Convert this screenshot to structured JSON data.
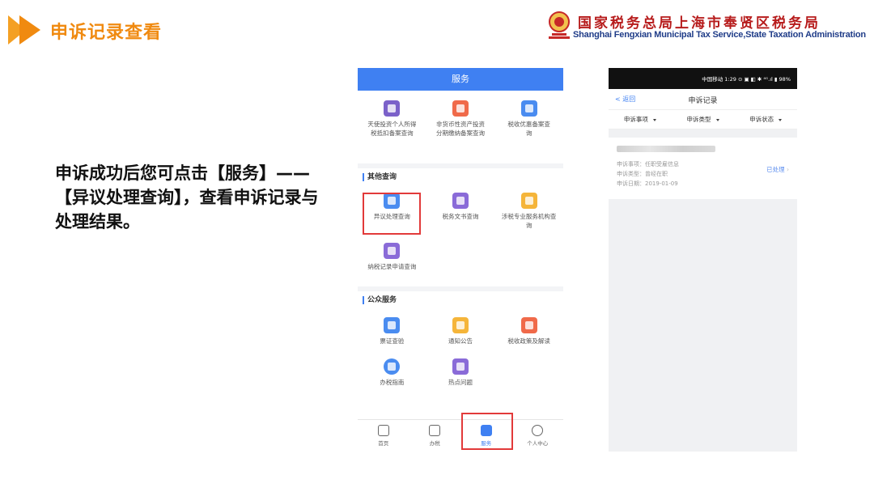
{
  "slide": {
    "title": "申诉记录查看",
    "bureau_cn": "国家税务总局上海市奉贤区税务局",
    "bureau_en": "Shanghai Fengxian Municipal Tax Service,State Taxation Administration",
    "instruction": "申诉成功后您可点击【服务】——【异议处理查询】，查看申诉记录与处理结果。"
  },
  "phone1": {
    "header": "服务",
    "top_items": [
      {
        "label": "天使投资个人所得税抵扣备案查询",
        "icon": "person-doc-icon",
        "color": "#7b61c9"
      },
      {
        "label": "非货币性资产投资分期缴纳备案查询",
        "icon": "clock-doc-icon",
        "color": "#f06a4a"
      },
      {
        "label": "税收优惠备案查询",
        "icon": "doc-icon",
        "color": "#4a8cf0"
      }
    ],
    "other_query": {
      "title": "其他查询",
      "items": [
        {
          "label": "异议处理查询",
          "icon": "objection-doc-icon",
          "color": "#4a8cf0"
        },
        {
          "label": "税务文书查询",
          "icon": "yen-doc-icon",
          "color": "#8a6bd8"
        },
        {
          "label": "涉税专业服务机构查询",
          "icon": "building-icon",
          "color": "#f5b53a"
        },
        {
          "label": "纳税记录申请查询",
          "icon": "record-doc-icon",
          "color": "#8a6bd8"
        }
      ]
    },
    "public_service": {
      "title": "公众服务",
      "items": [
        {
          "label": "票证查验",
          "icon": "ticket-icon",
          "color": "#4a8cf0"
        },
        {
          "label": "通知公告",
          "icon": "bell-icon",
          "color": "#f5b53a"
        },
        {
          "label": "税收政策及解读",
          "icon": "policy-book-icon",
          "color": "#f06a4a"
        },
        {
          "label": "办税指南",
          "icon": "compass-icon",
          "color": "#4a8cf0"
        },
        {
          "label": "热点问题",
          "icon": "question-icon",
          "color": "#8a6bd8"
        }
      ]
    },
    "tabs": [
      {
        "label": "首页",
        "icon": "home-icon"
      },
      {
        "label": "办税",
        "icon": "edit-doc-icon"
      },
      {
        "label": "服务",
        "icon": "heart-hand-icon"
      },
      {
        "label": "个人中心",
        "icon": "user-icon"
      }
    ]
  },
  "phone2": {
    "status_bar": "中国移动 1:29  ⊙ ▣ ◧ ✱ ⁴ᴳ.ıl ▮ 98%",
    "back": "返回",
    "title": "申诉记录",
    "filters": [
      "申诉事项",
      "申诉类型",
      "申诉状态"
    ],
    "record": {
      "matter": "申诉事项：任职受雇信息",
      "type": "申诉类型：曾经在职",
      "date": "申诉日期：2019-01-09",
      "status": "已处理"
    }
  }
}
